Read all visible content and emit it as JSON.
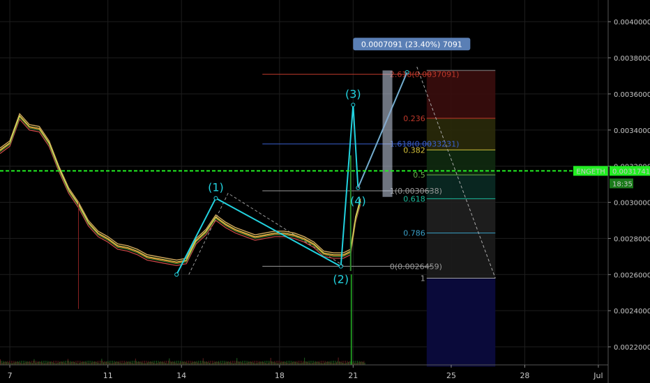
{
  "chart_data": {
    "type": "line",
    "symbol": "ENGETH",
    "last_price": "0.0031741",
    "countdown": "18:35",
    "colors": {
      "background": "#000000",
      "grid": "#1e1e1e",
      "price_line": "#22ee22",
      "wave": "#22d3e0",
      "ema1": "#e8e85a",
      "ema2": "#e57c2e",
      "ema3": "#d04a4a",
      "ema4": "#c9a35a",
      "fib_ext_red": "#c0392b",
      "fib_ext_blue": "#3a5fcd",
      "badge": "#5a7fb5"
    },
    "y_axis": {
      "ylim": [
        0.0021,
        0.00412
      ],
      "ticks": [
        "0.0040000",
        "0.0038000",
        "0.0036000",
        "0.0034000",
        "0.0032000",
        "0.0030000",
        "0.0028000",
        "0.0026000",
        "0.0024000",
        "0.0022000"
      ],
      "tick_values": [
        0.004,
        0.0038,
        0.0036,
        0.0034,
        0.0032,
        0.003,
        0.0028,
        0.0026,
        0.0024,
        0.0022
      ]
    },
    "x_axis": {
      "xlim": [
        6.6,
        31.4
      ],
      "ticks": [
        "7",
        "11",
        "14",
        "18",
        "21",
        "25",
        "28",
        "Jul"
      ],
      "tick_values": [
        7,
        11,
        14,
        18,
        21,
        25,
        28,
        31
      ]
    },
    "price_series": {
      "x": [
        6.6,
        7.0,
        7.4,
        7.8,
        8.2,
        8.6,
        9.0,
        9.4,
        9.8,
        10.2,
        10.6,
        11.0,
        11.4,
        11.8,
        12.2,
        12.6,
        13.0,
        13.4,
        13.8,
        14.2,
        14.6,
        15.0,
        15.4,
        15.8,
        16.2,
        16.6,
        17.0,
        17.4,
        17.8,
        18.2,
        18.6,
        19.0,
        19.4,
        19.8,
        20.2,
        20.6,
        20.9,
        21.1,
        21.3
      ],
      "y": [
        0.00328,
        0.00332,
        0.00347,
        0.00341,
        0.0034,
        0.00332,
        0.00318,
        0.00306,
        0.00298,
        0.00288,
        0.00282,
        0.00279,
        0.00275,
        0.00274,
        0.00272,
        0.00269,
        0.00268,
        0.00267,
        0.00266,
        0.00267,
        0.00278,
        0.00283,
        0.00291,
        0.00287,
        0.00284,
        0.00282,
        0.0028,
        0.00281,
        0.00282,
        0.00282,
        0.00281,
        0.00279,
        0.00276,
        0.00271,
        0.0027,
        0.0027,
        0.00272,
        0.0029,
        0.003
      ]
    },
    "elliott_wave": {
      "points": [
        {
          "label": "",
          "x": 13.8,
          "y": 0.0026
        },
        {
          "label": "(1)",
          "x": 15.4,
          "y": 0.003023
        },
        {
          "label": "(2)",
          "x": 20.5,
          "y": 0.002645
        },
        {
          "label": "(3)",
          "x": 21.0,
          "y": 0.00354
        },
        {
          "label": "(4)",
          "x": 21.2,
          "y": 0.00308
        },
        {
          "label": "",
          "x": 23.2,
          "y": 0.00372
        }
      ]
    },
    "fib_extension": {
      "levels": [
        {
          "label": "2.618(0.0037091)",
          "value": 0.0037091,
          "color": "#c0392b"
        },
        {
          "label": "1.618(0.0033231)",
          "value": 0.0033231,
          "color": "#3a5fcd"
        },
        {
          "label": "1(0.0030638)",
          "value": 0.0030638,
          "color": "#9a9a9a"
        },
        {
          "label": "0(0.0026459)",
          "value": 0.0026459,
          "color": "#9a9a9a"
        }
      ]
    },
    "fib_retracement": {
      "levels": [
        {
          "label": "0.236",
          "value": 0.003465,
          "color": "#c0392b",
          "band": "#3a0d0d"
        },
        {
          "label": "0.382",
          "value": 0.00329,
          "color": "#d4c13a",
          "band": "#2a2a0a"
        },
        {
          "label": "0.5",
          "value": 0.003152,
          "color": "#6ab04c",
          "band": "#102a10"
        },
        {
          "label": "0.618",
          "value": 0.00302,
          "color": "#1abc9c",
          "band": "#0a2a24"
        },
        {
          "label": "0.786",
          "value": 0.00283,
          "color": "#3aa0c8",
          "band": "#202020"
        },
        {
          "label": "1",
          "value": 0.00258,
          "color": "#a0a0a0",
          "band": "#1c1c1c"
        }
      ],
      "top_value": 0.00373,
      "bottom_value": 0.00209,
      "bottom_band": "#0a0a3a"
    },
    "measure_badge": "0.0007091 (23.40%) 7091"
  }
}
